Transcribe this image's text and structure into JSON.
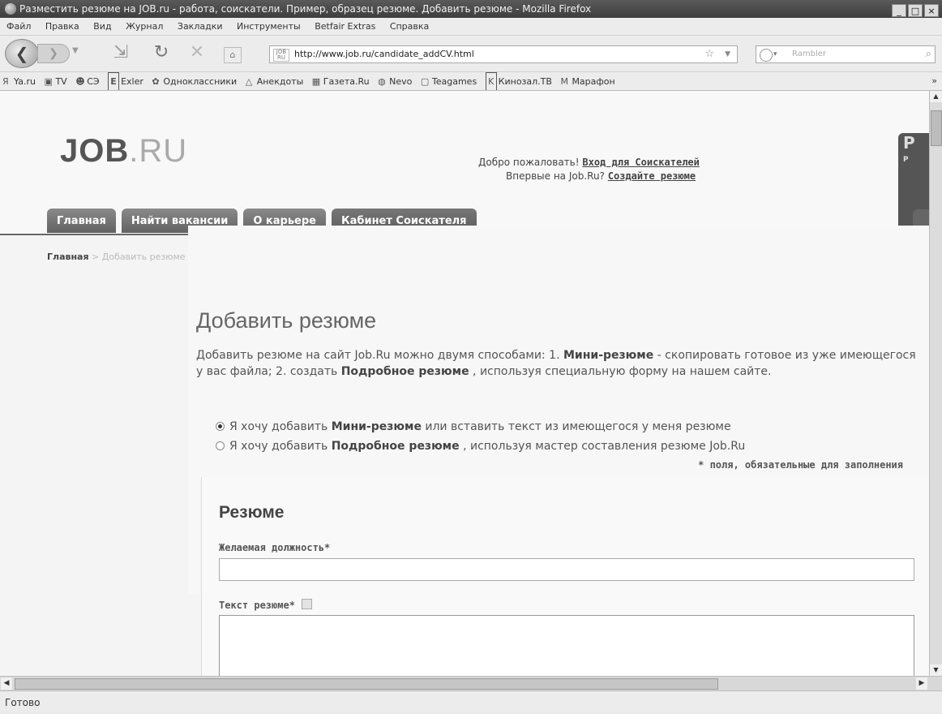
{
  "window": {
    "title": "Разместить резюме на JOB.ru - работа, соискатели. Пример, образец резюме. Добавить резюме - Mozilla Firefox",
    "minimize": "_",
    "maximize": "□",
    "close": "×"
  },
  "menu": [
    "Файл",
    "Правка",
    "Вид",
    "Журнал",
    "Закладки",
    "Инструменты",
    "Betfair Extras",
    "Справка"
  ],
  "address": {
    "url": "http://www.job.ru/candidate_addCV.html",
    "site_icon": "JOB RU"
  },
  "search": {
    "placeholder": "Rambler"
  },
  "bookmarks": [
    {
      "icon": "Я",
      "label": "Ya.ru"
    },
    {
      "icon": "▣",
      "label": "TV"
    },
    {
      "icon": "☻",
      "label": "СЭ"
    },
    {
      "icon": "E",
      "label": "Exler"
    },
    {
      "icon": "✿",
      "label": "Одноклассники"
    },
    {
      "icon": "△",
      "label": "Анекдоты"
    },
    {
      "icon": "▦",
      "label": "Газета.Ru"
    },
    {
      "icon": "◍",
      "label": "Nevo"
    },
    {
      "icon": "▢",
      "label": "Teagames"
    },
    {
      "icon": "K",
      "label": "Кинозал.ТВ"
    },
    {
      "icon": "M",
      "label": "Марафон"
    }
  ],
  "bookmarks_more": "»",
  "site": {
    "logo_main": "JOB",
    "logo_suffix": ".RU",
    "welcome_prefix": "Добро пожаловать! ",
    "login_link": "Вход для Соискателей",
    "welcome_line2": "Впервые на Job.Ru? ",
    "create_link": "Создайте резюме",
    "promo": "P",
    "promo_small": "P",
    "tabs": [
      "Главная",
      "Найти вакансии",
      "О карьере",
      "Кабинет Соискателя"
    ]
  },
  "breadcrumb": {
    "home": "Главная",
    "separator": " > ",
    "current": "Добавить резюме"
  },
  "main": {
    "heading": "Добавить резюме",
    "intro_1": "Добавить резюме на сайт Job.Ru можно двумя способами: 1. ",
    "intro_mini": "Мини-резюме",
    "intro_2": " - скопировать готовое из уже имеющегося у вас файла; 2. создать ",
    "intro_detailed": "Подробное резюме",
    "intro_3": " , используя специальную форму на нашем сайте.",
    "option1_pre": "Я хочу добавить ",
    "option1_bold": "Мини-резюме",
    "option1_post": " или вставить текст из имеющегося у меня резюме",
    "option2_pre": "Я хочу добавить ",
    "option2_bold": "Подробное резюме",
    "option2_post": " , используя мастер составления резюме Job.Ru",
    "required_note": "* поля, обязательные для заполнения"
  },
  "form": {
    "title": "Резюме",
    "position_label": "Желаемая должность*",
    "text_label": "Текст резюме*"
  },
  "status": "Готово"
}
